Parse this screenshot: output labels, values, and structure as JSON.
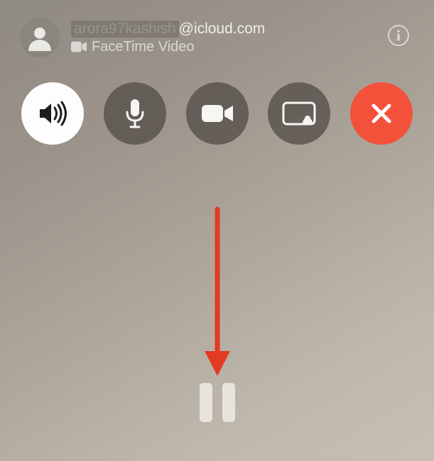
{
  "header": {
    "contact_name_blurred": "arora97kashish",
    "contact_name_suffix": "@icloud.com",
    "call_type_label": "FaceTime Video"
  },
  "icons": {
    "avatar": "person-silhouette-icon",
    "info": "info-icon",
    "call_type": "video-icon",
    "speaker": "speaker-icon",
    "mic": "microphone-icon",
    "camera": "camera-icon",
    "screenshare": "screenshare-icon",
    "end": "close-icon",
    "pause": "pause-icon"
  },
  "annotation": {
    "arrow_color": "#e33a24"
  }
}
